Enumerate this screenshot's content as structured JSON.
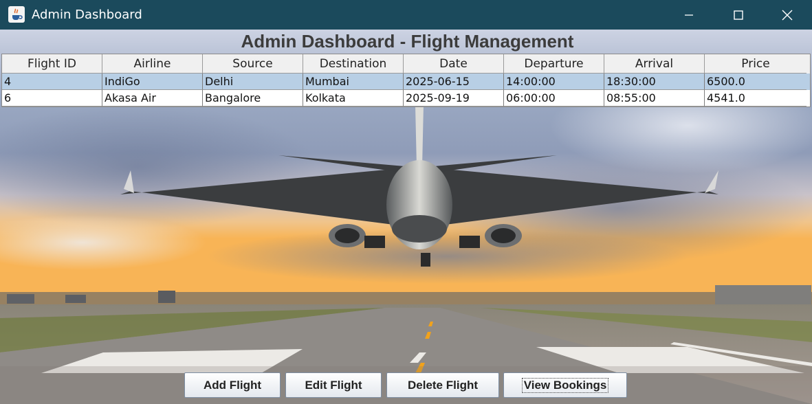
{
  "window": {
    "title": "Admin Dashboard",
    "icon": "java-coffee-icon",
    "controls": [
      "minimize-icon",
      "maximize-icon",
      "close-icon"
    ]
  },
  "heading": "Admin Dashboard - Flight Management",
  "table": {
    "columns": [
      "Flight ID",
      "Airline",
      "Source",
      "Destination",
      "Date",
      "Departure",
      "Arrival",
      "Price"
    ],
    "rows": [
      [
        "4",
        "IndiGo",
        "Delhi",
        "Mumbai",
        "2025-06-15",
        "14:00:00",
        "18:30:00",
        "6500.0"
      ],
      [
        "6",
        "Akasa Air",
        "Bangalore",
        "Kolkata",
        "2025-09-19",
        "06:00:00",
        "08:55:00",
        "4541.0"
      ]
    ],
    "selected_row": 0
  },
  "buttons": {
    "add": "Add Flight",
    "edit": "Edit Flight",
    "delete": "Delete Flight",
    "view": "View Bookings"
  },
  "colors": {
    "titlebar": "#1b4a5c",
    "selection": "#b8cfe5"
  }
}
